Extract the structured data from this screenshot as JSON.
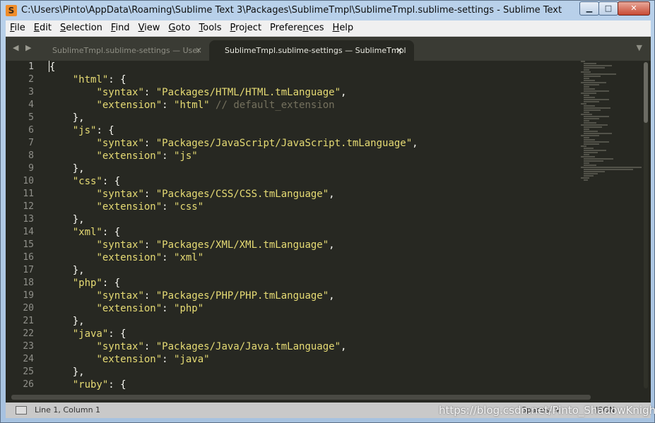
{
  "window": {
    "title": "C:\\Users\\Pinto\\AppData\\Roaming\\Sublime Text 3\\Packages\\SublimeTmpl\\SublimeTmpl.sublime-settings - Sublime Text",
    "app_icon_glyph": "S",
    "min_glyph": "▁",
    "max_glyph": "□",
    "close_glyph": "✕"
  },
  "menu": [
    {
      "u": "F",
      "rest": "ile"
    },
    {
      "u": "E",
      "rest": "dit"
    },
    {
      "u": "S",
      "rest": "election"
    },
    {
      "u": "F",
      "pre": "",
      "rest": "ind",
      "special": "Fi",
      "label": "Find"
    },
    {
      "u": "V",
      "rest": "iew"
    },
    {
      "u": "G",
      "rest": "oto"
    },
    {
      "u": "T",
      "rest": "ools"
    },
    {
      "u": "P",
      "rest": "roject"
    },
    {
      "u": "n",
      "pre": "Prefere",
      "rest": "ces"
    },
    {
      "u": "H",
      "rest": "elp"
    }
  ],
  "tabs": {
    "nav_glyph": "◀ ▶",
    "dropdown_glyph": "▼",
    "close_glyph": "×",
    "inactive_label": "SublimeTmpl.sublime-settings — User",
    "active_label": "SublimeTmpl.sublime-settings — SublimeTmpl"
  },
  "code": {
    "line_numbers": [
      "1",
      "2",
      "3",
      "4",
      "5",
      "6",
      "7",
      "8",
      "9",
      "10",
      "11",
      "12",
      "13",
      "14",
      "15",
      "16",
      "17",
      "18",
      "19",
      "20",
      "21",
      "22",
      "23",
      "24",
      "25",
      "26"
    ],
    "lines": [
      [
        {
          "t": "{"
        }
      ],
      [
        {
          "t": "    "
        },
        {
          "t": "\"html\"",
          "c": "s"
        },
        {
          "t": ": {"
        }
      ],
      [
        {
          "t": "        "
        },
        {
          "t": "\"syntax\"",
          "c": "s"
        },
        {
          "t": ": "
        },
        {
          "t": "\"Packages/HTML/HTML.tmLanguage\"",
          "c": "s"
        },
        {
          "t": ","
        }
      ],
      [
        {
          "t": "        "
        },
        {
          "t": "\"extension\"",
          "c": "s"
        },
        {
          "t": ": "
        },
        {
          "t": "\"html\"",
          "c": "s"
        },
        {
          "t": " "
        },
        {
          "t": "// default_extension",
          "c": "c"
        }
      ],
      [
        {
          "t": "    },"
        }
      ],
      [
        {
          "t": "    "
        },
        {
          "t": "\"js\"",
          "c": "s"
        },
        {
          "t": ": {"
        }
      ],
      [
        {
          "t": "        "
        },
        {
          "t": "\"syntax\"",
          "c": "s"
        },
        {
          "t": ": "
        },
        {
          "t": "\"Packages/JavaScript/JavaScript.tmLanguage\"",
          "c": "s"
        },
        {
          "t": ","
        }
      ],
      [
        {
          "t": "        "
        },
        {
          "t": "\"extension\"",
          "c": "s"
        },
        {
          "t": ": "
        },
        {
          "t": "\"js\"",
          "c": "s"
        }
      ],
      [
        {
          "t": "    },"
        }
      ],
      [
        {
          "t": "    "
        },
        {
          "t": "\"css\"",
          "c": "s"
        },
        {
          "t": ": {"
        }
      ],
      [
        {
          "t": "        "
        },
        {
          "t": "\"syntax\"",
          "c": "s"
        },
        {
          "t": ": "
        },
        {
          "t": "\"Packages/CSS/CSS.tmLanguage\"",
          "c": "s"
        },
        {
          "t": ","
        }
      ],
      [
        {
          "t": "        "
        },
        {
          "t": "\"extension\"",
          "c": "s"
        },
        {
          "t": ": "
        },
        {
          "t": "\"css\"",
          "c": "s"
        }
      ],
      [
        {
          "t": "    },"
        }
      ],
      [
        {
          "t": "    "
        },
        {
          "t": "\"xml\"",
          "c": "s"
        },
        {
          "t": ": {"
        }
      ],
      [
        {
          "t": "        "
        },
        {
          "t": "\"syntax\"",
          "c": "s"
        },
        {
          "t": ": "
        },
        {
          "t": "\"Packages/XML/XML.tmLanguage\"",
          "c": "s"
        },
        {
          "t": ","
        }
      ],
      [
        {
          "t": "        "
        },
        {
          "t": "\"extension\"",
          "c": "s"
        },
        {
          "t": ": "
        },
        {
          "t": "\"xml\"",
          "c": "s"
        }
      ],
      [
        {
          "t": "    },"
        }
      ],
      [
        {
          "t": "    "
        },
        {
          "t": "\"php\"",
          "c": "s"
        },
        {
          "t": ": {"
        }
      ],
      [
        {
          "t": "        "
        },
        {
          "t": "\"syntax\"",
          "c": "s"
        },
        {
          "t": ": "
        },
        {
          "t": "\"Packages/PHP/PHP.tmLanguage\"",
          "c": "s"
        },
        {
          "t": ","
        }
      ],
      [
        {
          "t": "        "
        },
        {
          "t": "\"extension\"",
          "c": "s"
        },
        {
          "t": ": "
        },
        {
          "t": "\"php\"",
          "c": "s"
        }
      ],
      [
        {
          "t": "    },"
        }
      ],
      [
        {
          "t": "    "
        },
        {
          "t": "\"java\"",
          "c": "s"
        },
        {
          "t": ": {"
        }
      ],
      [
        {
          "t": "        "
        },
        {
          "t": "\"syntax\"",
          "c": "s"
        },
        {
          "t": ": "
        },
        {
          "t": "\"Packages/Java/Java.tmLanguage\"",
          "c": "s"
        },
        {
          "t": ","
        }
      ],
      [
        {
          "t": "        "
        },
        {
          "t": "\"extension\"",
          "c": "s"
        },
        {
          "t": ": "
        },
        {
          "t": "\"java\"",
          "c": "s"
        }
      ],
      [
        {
          "t": "    },"
        }
      ],
      [
        {
          "t": "    "
        },
        {
          "t": "\"ruby\"",
          "c": "s"
        },
        {
          "t": ": {"
        }
      ]
    ],
    "colors": {
      "string": "#e6db74",
      "comment": "#75715e",
      "text": "#f8f8f2",
      "background": "#272822"
    }
  },
  "status": {
    "position": "Line 1, Column 1",
    "tab_size": "Spaces: 4",
    "syntax": "JSON"
  },
  "watermark": "https://blog.csdn.net/Pinto_ShadowKnight"
}
